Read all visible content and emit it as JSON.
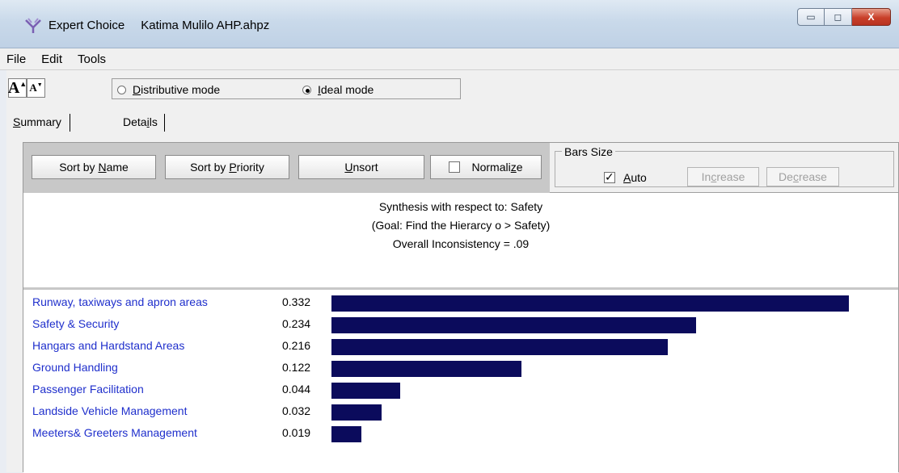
{
  "window": {
    "app_name": "Expert Choice",
    "document_name": "Katima Mulilo AHP.ahpz",
    "min_glyph": "▭",
    "max_glyph": "◻",
    "close_glyph": "X"
  },
  "menu": [
    "File",
    "Edit",
    "Tools"
  ],
  "toolbar": {
    "font_increase_glyph": "A",
    "font_decrease_glyph": "A",
    "modes": [
      {
        "label": "Distributive mode",
        "selected": false
      },
      {
        "label": "Ideal mode",
        "selected": true
      }
    ]
  },
  "tabs": [
    {
      "label": "Summary",
      "active": true
    },
    {
      "label": "Details",
      "active": false
    }
  ],
  "buttons": {
    "sort_by_name": "Sort by Name",
    "sort_by_priority": "Sort by Priority",
    "unsort": "Unsort",
    "normalize": "Normalize",
    "normalize_checked": false
  },
  "bars_size": {
    "title": "Bars Size",
    "auto_label": "Auto",
    "auto_checked": true,
    "increase": "Increase",
    "decrease": "Decrease"
  },
  "synthesis": {
    "line1": "Synthesis with respect to: Safety",
    "line2": "(Goal: Find the Hierarcy o > Safety)",
    "line3": "Overall Inconsistency = .09"
  },
  "colors": {
    "bar": "#0b0b5c",
    "label": "#1f2fcc"
  },
  "chart_data": {
    "type": "bar",
    "orientation": "horizontal",
    "categories": [
      "Runway, taxiways and apron areas",
      "Safety & Security",
      "Hangars and Hardstand Areas",
      "Ground Handling",
      "Passenger Facilitation",
      "Landside Vehicle Management",
      "Meeters& Greeters Management"
    ],
    "value_labels": [
      "0.332",
      "0.234",
      "0.216",
      "0.122",
      "0.044",
      "0.032",
      "0.019"
    ],
    "values": [
      0.332,
      0.234,
      0.216,
      0.122,
      0.044,
      0.032,
      0.019
    ]
  }
}
